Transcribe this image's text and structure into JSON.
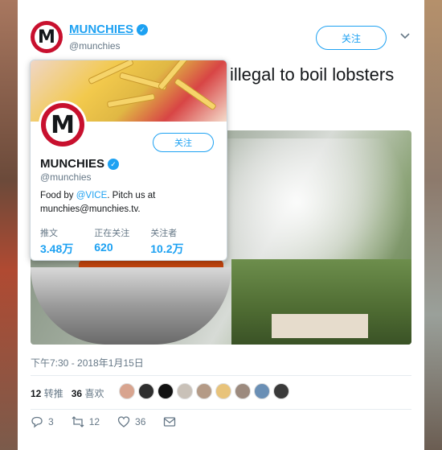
{
  "account": {
    "name": "MUNCHIES",
    "handle": "@munchies",
    "avatar_letter": "M"
  },
  "header": {
    "follow_label": "关注"
  },
  "tweet": {
    "text": "illegal to boil lobsters",
    "timestamp": "下午7:30 - 2018年1月15日"
  },
  "stats": {
    "retweets_count": "12",
    "retweets_label": "转推",
    "likes_count": "36",
    "likes_label": "喜欢"
  },
  "actions": {
    "reply_count": "3",
    "retweet_count": "12",
    "like_count": "36"
  },
  "hover_card": {
    "name": "MUNCHIES",
    "handle": "@munchies",
    "follow_label": "关注",
    "bio_prefix": "Food by ",
    "bio_link": "@VICE",
    "bio_suffix": ". Pitch us at",
    "bio_line2": "munchies@munchies.tv.",
    "stats": [
      {
        "label": "推文",
        "value": "3.48万"
      },
      {
        "label": "正在关注",
        "value": "620"
      },
      {
        "label": "关注者",
        "value": "10.2万"
      }
    ]
  },
  "colors": {
    "accent": "#1da1f2",
    "brand_red": "#c8102e"
  }
}
